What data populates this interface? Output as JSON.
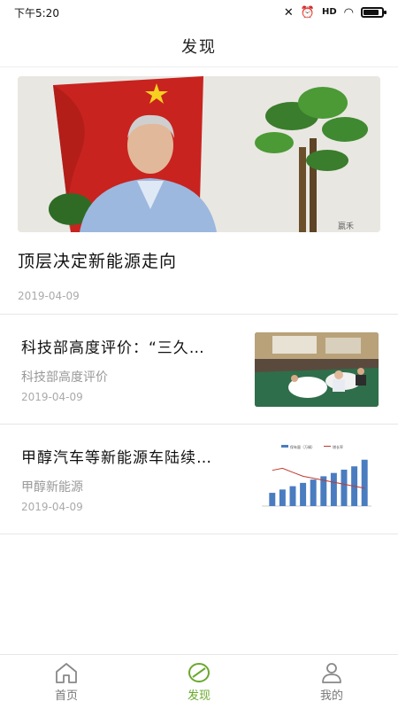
{
  "status_bar": {
    "time": "下午5:20",
    "signal": "HD"
  },
  "header": {
    "title": "发现"
  },
  "hero_article": {
    "title": "顶层决定新能源走向",
    "date": "2019-04-09",
    "image_watermark": "嬴禾"
  },
  "articles": [
    {
      "title": "科技部高度评价：“三久…",
      "source": "科技部高度评价",
      "date": "2019-04-09"
    },
    {
      "title": "甲醇汽车等新能源车陆续…",
      "source": "甲醇新能源",
      "date": "2019-04-09"
    }
  ],
  "thumb_chart": {
    "type": "bar",
    "legend": [
      "保有量（万辆）",
      "增长率"
    ],
    "values": [
      4,
      5,
      6,
      7,
      8,
      9,
      10,
      11,
      12,
      14
    ],
    "growth": [
      18,
      19,
      17,
      15,
      14,
      13,
      12,
      11,
      10,
      9
    ],
    "colors": {
      "bar": "#4a7cc0",
      "line": "#c0392b"
    }
  },
  "tabbar": {
    "tabs": [
      {
        "label": "首页",
        "icon": "home-icon",
        "active": false
      },
      {
        "label": "发现",
        "icon": "discover-icon",
        "active": true
      },
      {
        "label": "我的",
        "icon": "user-icon",
        "active": false
      }
    ]
  },
  "colors": {
    "accent": "#6aa82c"
  },
  "battery_level": 0.85
}
